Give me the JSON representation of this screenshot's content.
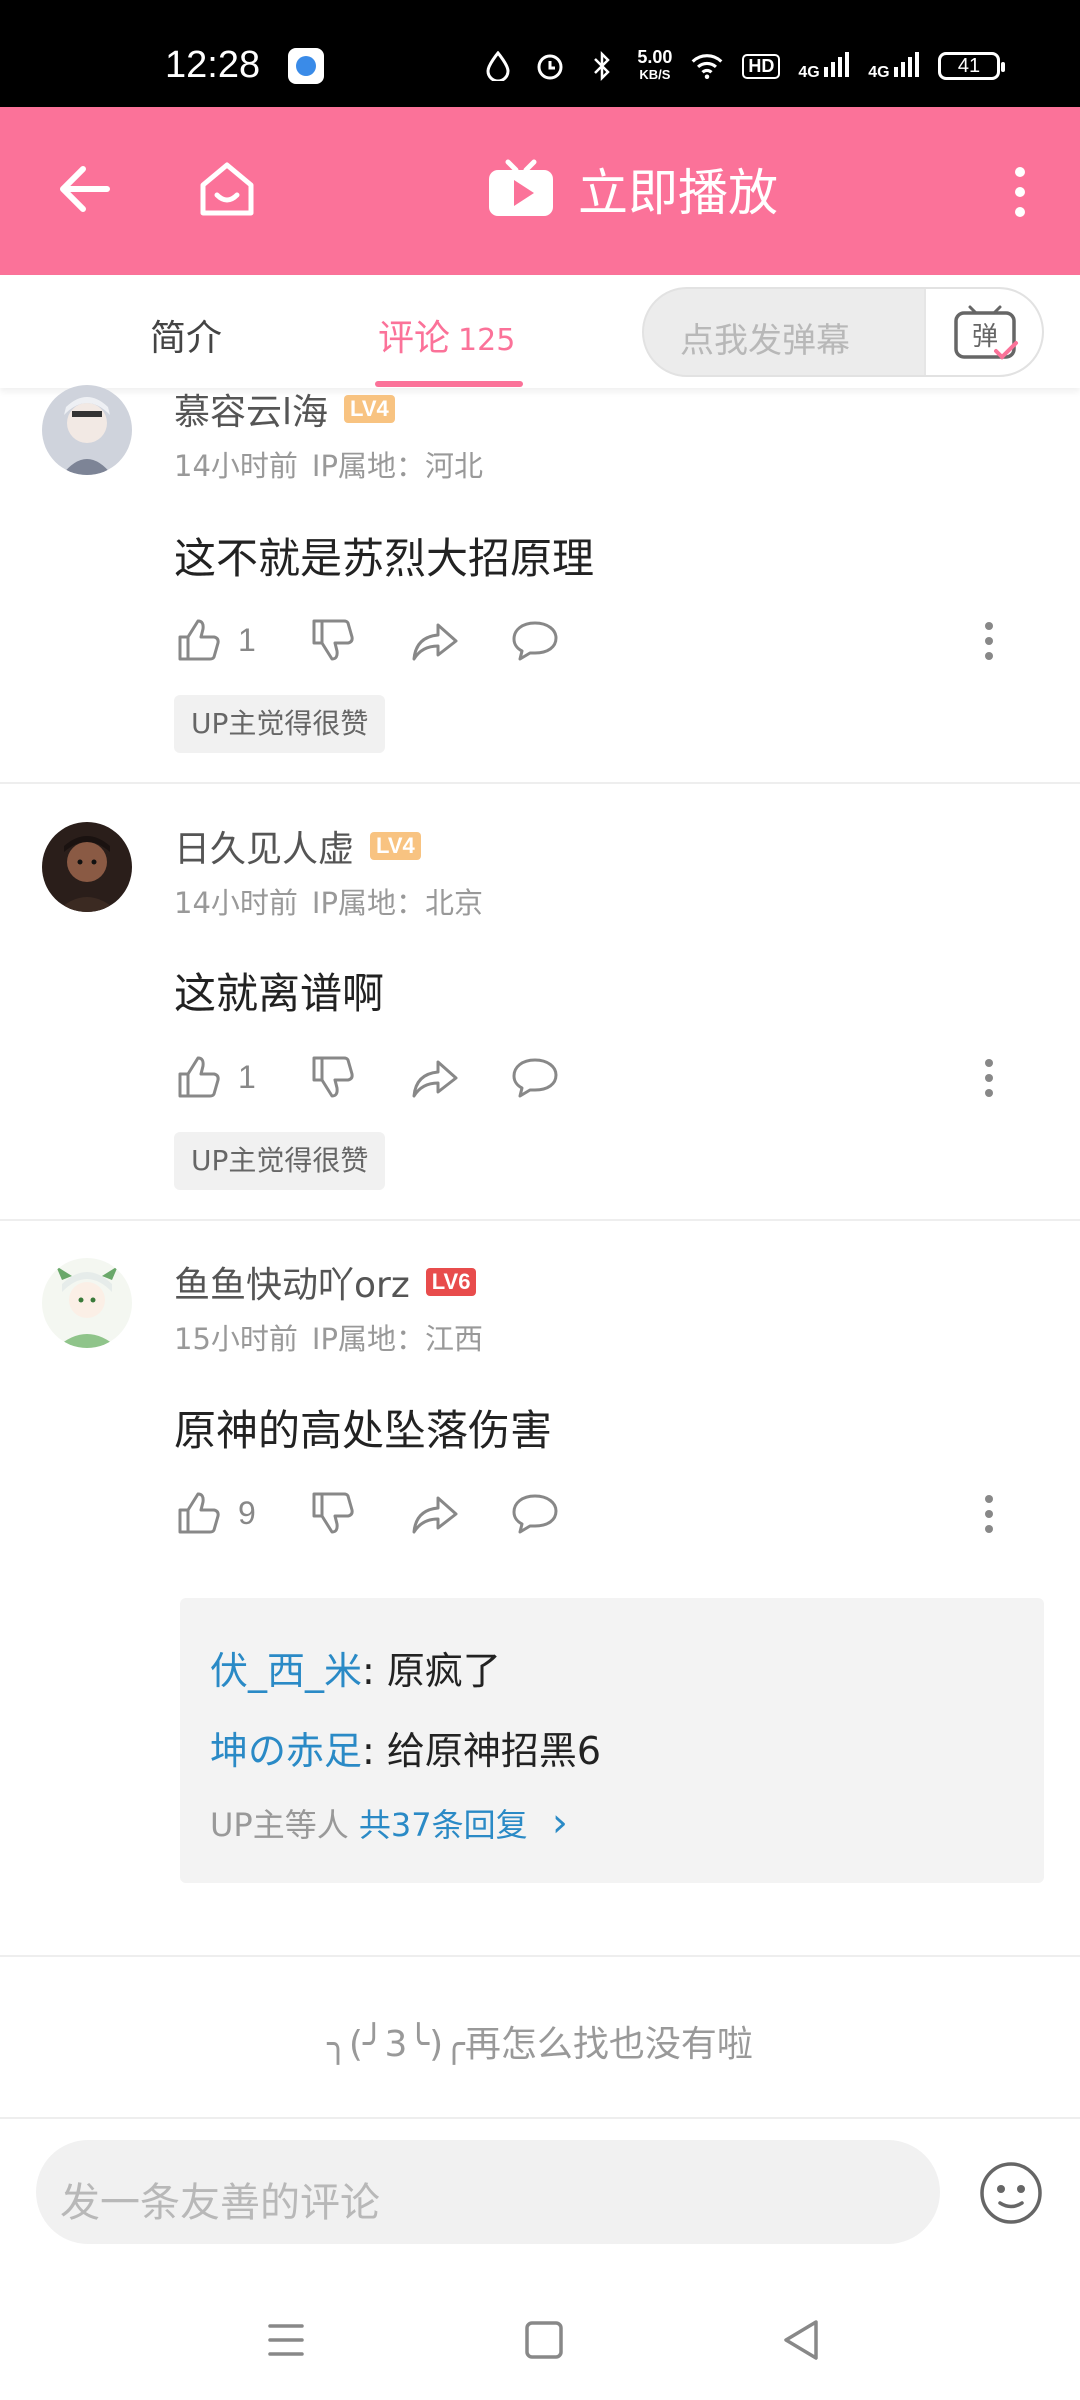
{
  "status_bar": {
    "time": "12:28",
    "speed_value": "5.00",
    "speed_unit": "KB/S",
    "hd_label": "HD",
    "net1": "4G",
    "net2": "4G",
    "battery": "41"
  },
  "header": {
    "title": "立即播放",
    "back_icon": "back-arrow-icon",
    "home_icon": "home-icon",
    "more_icon": "more-vertical-icon"
  },
  "tabs": {
    "intro": "简介",
    "comments": "评论",
    "comment_count": "125",
    "danmaku_placeholder": "点我发弹幕",
    "danmaku_button": "弹"
  },
  "comments": [
    {
      "user": "慕容云l海",
      "level": "LV4",
      "time": "14小时前",
      "ip": "IP属地：河北",
      "text": "这不就是苏烈大招原理",
      "likes": "1",
      "badge": "UP主觉得很赞"
    },
    {
      "user": "日久见人虚",
      "level": "LV4",
      "time": "14小时前",
      "ip": "IP属地：北京",
      "text": "这就离谱啊",
      "likes": "1",
      "badge": "UP主觉得很赞"
    },
    {
      "user": "鱼鱼快动吖orz",
      "level": "LV6",
      "time": "15小时前",
      "ip": "IP属地：江西",
      "text": "原神的高处坠落伤害",
      "likes": "9",
      "replies": [
        {
          "name": "伏_西_米",
          "sep": ": ",
          "text": "原疯了"
        },
        {
          "name": "坤の赤足",
          "sep": ": ",
          "text": "给原神招黑6"
        }
      ],
      "reply_prefix": "UP主等人 ",
      "reply_link": "共37条回复",
      "reply_chevron": "›"
    }
  ],
  "end_text": "╮(╯3╰)╭再怎么找也没有啦",
  "bottom": {
    "comment_placeholder": "发一条友善的评论",
    "emoji_icon": "emoji-icon"
  },
  "colors": {
    "brand_pink": "#fb7299",
    "link_blue": "#2a8ac6",
    "level4": "#f8c381",
    "level6": "#e84c4c"
  }
}
